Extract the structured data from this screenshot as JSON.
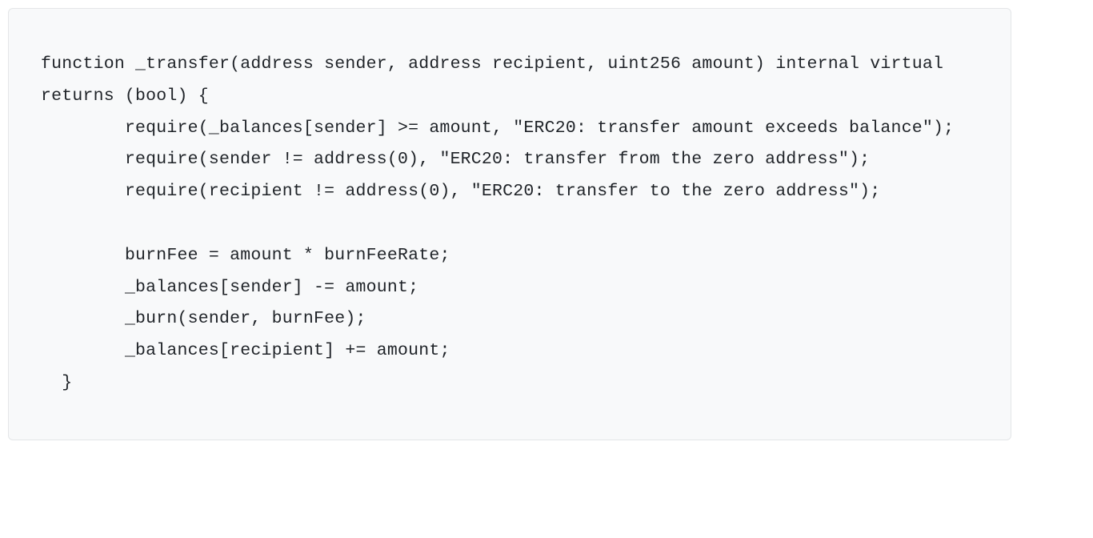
{
  "code": {
    "line1": "function _transfer(address sender, address recipient, uint256 amount) internal virtual returns (bool) {",
    "line2": "        require(_balances[sender] >= amount, \"ERC20: transfer amount exceeds balance\");",
    "line3": "        require(sender != address(0), \"ERC20: transfer from the zero address\");",
    "line4": "        require(recipient != address(0), \"ERC20: transfer to the zero address\");",
    "line5": "",
    "line6": "        burnFee = amount * burnFeeRate;",
    "line7": "        _balances[sender] -= amount;",
    "line8": "        _burn(sender, burnFee);",
    "line9": "        _balances[recipient] += amount;",
    "line10": "  }"
  }
}
